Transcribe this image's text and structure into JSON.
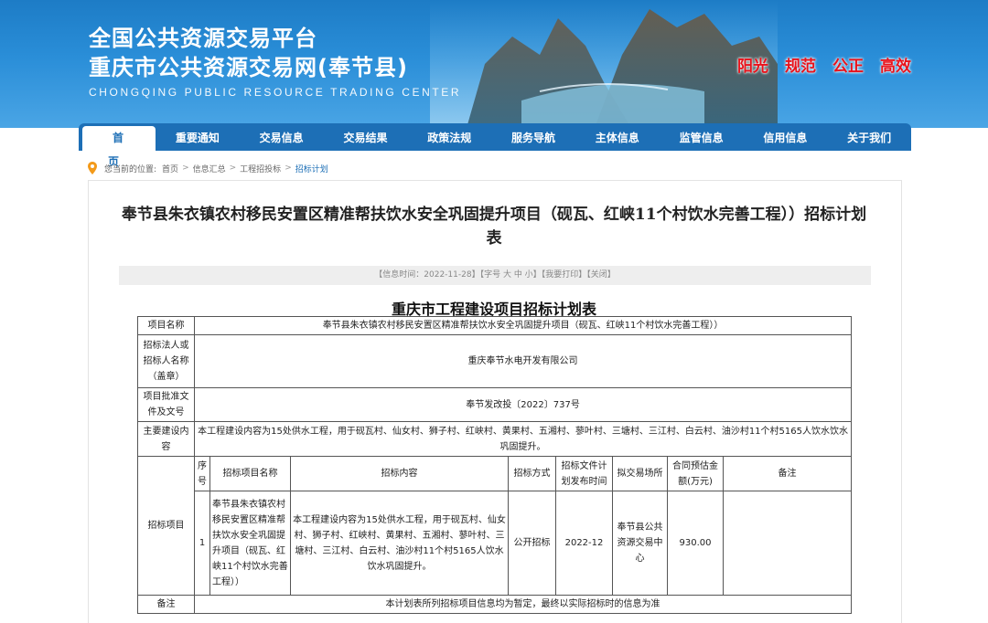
{
  "header": {
    "title_line1": "全国公共资源交易平台",
    "title_line2": "重庆市公共资源交易网(奉节县)",
    "title_en": "CHONGQING PUBLIC RESOURCE TRADING CENTER",
    "slogans": [
      "阳光",
      "规范",
      "公正",
      "高效"
    ]
  },
  "nav": {
    "items": [
      "首　页",
      "重要通知",
      "交易信息",
      "交易结果",
      "政策法规",
      "服务导航",
      "主体信息",
      "监管信息",
      "信用信息",
      "关于我们"
    ]
  },
  "breadcrumb": {
    "prefix": "您当前的位置:",
    "items": [
      "首页",
      "信息汇总",
      "工程招投标",
      "招标计划"
    ],
    "sep": ">"
  },
  "article": {
    "title": "奉节县朱衣镇农村移民安置区精准帮扶饮水安全巩固提升项目（砚瓦、红峡11个村饮水完善工程））招标计划表",
    "info_date": "【信息时间：2022-11-28】",
    "info_font": "【字号 大 中 小】",
    "info_print": "【我要打印】",
    "info_close": "【关闭】"
  },
  "table": {
    "title": "重庆市工程建设项目招标计划表",
    "row_project_label": "项目名称",
    "row_project_value": "奉节县朱衣镇农村移民安置区精准帮扶饮水安全巩固提升项目（砚瓦、红峡11个村饮水完善工程））",
    "row_tenderer_label": "招标法人或招标人名称（盖章）",
    "row_tenderer_value": "重庆奉节水电开发有限公司",
    "row_approval_label": "项目批准文件及文号",
    "row_approval_value": "奉节发改投〔2022〕737号",
    "row_content_label": "主要建设内容",
    "row_content_value": "本工程建设内容为15处供水工程，用于砚瓦村、仙女村、狮子村、红峡村、黄果村、五湘村、蓼叶村、三塘村、三江村、白云村、油沙村11个村5165人饮水饮水巩固提升。",
    "items_label": "招标项目",
    "headers": [
      "序号",
      "招标项目名称",
      "招标内容",
      "招标方式",
      "招标文件计划发布时间",
      "拟交易场所",
      "合同预估金额(万元)",
      "备注"
    ],
    "item": {
      "no": "1",
      "name": "奉节县朱衣镇农村移民安置区精准帮扶饮水安全巩固提升项目（砚瓦、红峡11个村饮水完善工程））",
      "content": "本工程建设内容为15处供水工程，用于砚瓦村、仙女村、狮子村、红峡村、黄果村、五湘村、蓼叶村、三塘村、三江村、白云村、油沙村11个村5165人饮水饮水巩固提升。",
      "method": "公开招标",
      "publish_time": "2022-12",
      "venue": "奉节县公共资源交易中心",
      "amount": "930.00",
      "remark": ""
    },
    "note_label": "备注",
    "note_value": "本计划表所列招标项目信息均为暂定，最终以实际招标时的信息为准"
  },
  "colors": {
    "nav_blue": "#1d6fb6",
    "banner_blue": "#2a8ed8",
    "slogan_red": "#e8121b"
  }
}
